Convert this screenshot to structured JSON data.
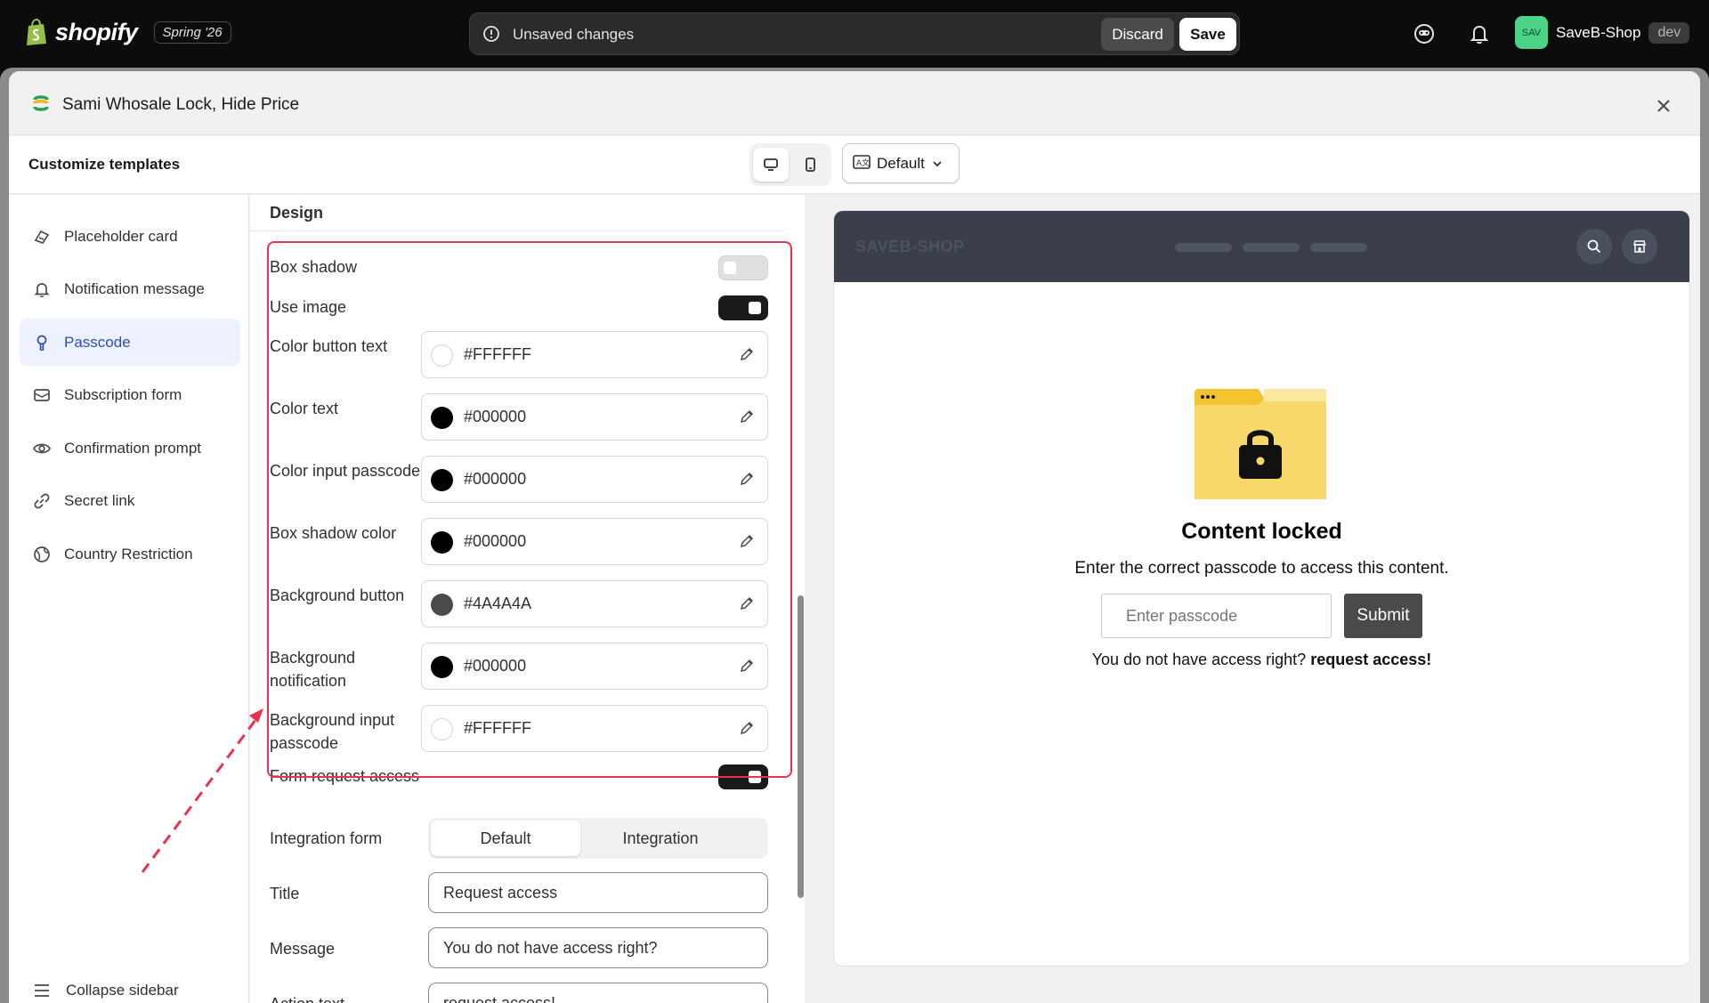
{
  "topbar": {
    "brand": "shopify",
    "edition": "Spring '26",
    "unsaved_text": "Unsaved changes",
    "discard_label": "Discard",
    "save_label": "Save",
    "store_avatar": "SAV",
    "store_name": "SaveB-Shop",
    "store_tag": "dev"
  },
  "modal": {
    "app_title": "Sami Whosale Lock, Hide Price",
    "toolbar_title": "Customize templates",
    "language": "Default"
  },
  "sidebar": {
    "items": [
      {
        "label": "Placeholder card",
        "icon": "card-icon"
      },
      {
        "label": "Notification message",
        "icon": "bell-icon"
      },
      {
        "label": "Passcode",
        "icon": "key-icon",
        "active": true
      },
      {
        "label": "Subscription form",
        "icon": "mail-icon"
      },
      {
        "label": "Confirmation prompt",
        "icon": "eye-icon"
      },
      {
        "label": "Secret link",
        "icon": "link-icon"
      },
      {
        "label": "Country Restriction",
        "icon": "globe-icon"
      }
    ],
    "collapse_label": "Collapse sidebar"
  },
  "design": {
    "title": "Design",
    "box_shadow_label": "Box shadow",
    "box_shadow_on": false,
    "use_image_label": "Use image",
    "use_image_on": true,
    "colors": [
      {
        "label": "Color button text",
        "value": "#FFFFFF"
      },
      {
        "label": "Color text",
        "value": "#000000"
      },
      {
        "label": "Color input passcode",
        "value": "#000000"
      },
      {
        "label": "Box shadow color",
        "value": "#000000"
      },
      {
        "label": "Background button",
        "value": "#4A4A4A"
      },
      {
        "label": "Background notification",
        "value": "#000000"
      },
      {
        "label": "Background input passcode",
        "value": "#FFFFFF"
      }
    ],
    "form_request_label": "Form request access",
    "form_request_on": true,
    "integration_label": "Integration form",
    "integration_options": [
      "Default",
      "Integration"
    ],
    "integration_selected": "Default",
    "title_label": "Title",
    "title_value": "Request access",
    "message_label": "Message",
    "message_value": "You do not have access right?",
    "action_label": "Action text",
    "action_value": "request access!"
  },
  "preview": {
    "store_brand": "SAVEB-SHOP",
    "locked_title": "Content locked",
    "locked_message": "Enter the correct passcode to access this content.",
    "passcode_placeholder": "Enter passcode",
    "submit_label": "Submit",
    "access_text": "You do not have access right?",
    "access_link": "request access!"
  },
  "colors": {
    "accent": "#2c4bb8",
    "highlight": "#e8324f",
    "button_bg": "#4A4A4A"
  }
}
